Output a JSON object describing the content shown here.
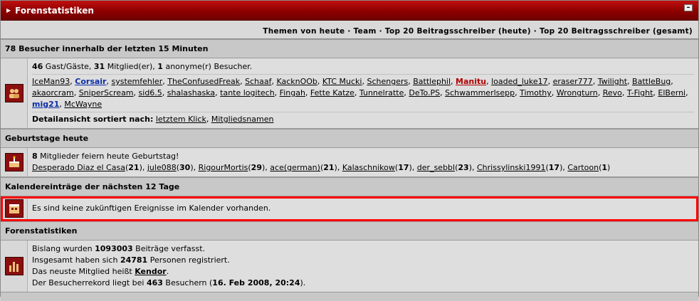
{
  "header": {
    "title": "Forenstatistiken",
    "collapse_symbol": "–"
  },
  "links": [
    {
      "label": "Themen von heute"
    },
    {
      "label": "Team"
    },
    {
      "label": "Top 20 Beitragsschreiber (heute)"
    },
    {
      "label": "Top 20 Beitragsschreiber (gesamt)"
    }
  ],
  "visitors": {
    "heading": "78 Besucher innerhalb der letzten 15 Minuten",
    "guests_count": "46",
    "guests_label": " Gast/Gäste, ",
    "members_count": "31",
    "members_label": " Mitglied(er), ",
    "anon_count": "1",
    "anon_label": " anonyme(r) Besucher.",
    "users": [
      {
        "name": "IceMan93",
        "style": "u"
      },
      {
        "name": "Corsair",
        "style": "blue"
      },
      {
        "name": "systemfehler",
        "style": "u"
      },
      {
        "name": "TheConfusedFreak",
        "style": "u"
      },
      {
        "name": "Schaaf",
        "style": "u"
      },
      {
        "name": "KacknOOb",
        "style": "u"
      },
      {
        "name": "KTC Mucki",
        "style": "u"
      },
      {
        "name": "Schengers",
        "style": "u"
      },
      {
        "name": "Battlephil",
        "style": "u"
      },
      {
        "name": "Manitu",
        "style": "red"
      },
      {
        "name": "loaded_luke17",
        "style": "u"
      },
      {
        "name": "eraser777",
        "style": "u"
      },
      {
        "name": "Twilight",
        "style": "u"
      },
      {
        "name": "BattleBug",
        "style": "u"
      },
      {
        "name": "akaorcram",
        "style": "u"
      },
      {
        "name": "SniperScream",
        "style": "u"
      },
      {
        "name": "sid6.5",
        "style": "u"
      },
      {
        "name": "shalashaska",
        "style": "u"
      },
      {
        "name": "tante logitech",
        "style": "u"
      },
      {
        "name": "Fingah",
        "style": "u"
      },
      {
        "name": "Fette Katze",
        "style": "u"
      },
      {
        "name": "Tunnelratte",
        "style": "u"
      },
      {
        "name": "DeTo.PS",
        "style": "u"
      },
      {
        "name": "Schwammerlsepp",
        "style": "u"
      },
      {
        "name": "Timothy",
        "style": "u"
      },
      {
        "name": "Wrongturn",
        "style": "u"
      },
      {
        "name": "Revo",
        "style": "u"
      },
      {
        "name": "T-Fight",
        "style": "u"
      },
      {
        "name": "ElBerni",
        "style": "u"
      },
      {
        "name": "mig21",
        "style": "blue"
      },
      {
        "name": "McWayne",
        "style": "u"
      }
    ],
    "sort_label": "Detailansicht sortiert nach:",
    "sort_by_click": "letztem Klick",
    "sort_by_name": "Mitgliedsnamen"
  },
  "birthdays": {
    "heading": "Geburtstage heute",
    "count": "8",
    "text": " Mitglieder feiern heute Geburtstag!",
    "people": [
      {
        "name": "Desperado Diaz el Casa",
        "age": "21"
      },
      {
        "name": "jule088",
        "age": "30"
      },
      {
        "name": "RigourMortis",
        "age": "29"
      },
      {
        "name": "ace(german)",
        "age": "21"
      },
      {
        "name": "Kalaschnikow",
        "age": "17"
      },
      {
        "name": "der_sebbl",
        "age": "23"
      },
      {
        "name": "Chrissylinski1991",
        "age": "17"
      },
      {
        "name": "Cartoon",
        "age": "1"
      }
    ]
  },
  "calendar": {
    "heading": "Kalendereinträge der nächsten 12 Tage",
    "message": "Es sind keine zukünftigen Ereignisse im Kalender vorhanden."
  },
  "stats": {
    "heading": "Forenstatistiken",
    "line1_pre": "Bislang wurden ",
    "posts": "1093003",
    "line1_post": " Beiträge verfasst.",
    "line2_pre": "Insgesamt haben sich ",
    "registered": "24781",
    "line2_post": " Personen registriert.",
    "line3_pre": "Das neuste Mitglied heißt ",
    "newest": "Kendor",
    "line3_post": ".",
    "line4_pre": "Der Besucherrekord liegt bei ",
    "record": "463",
    "line4_mid": " Besuchern (",
    "record_date": "16. Feb 2008, 20:24",
    "line4_post": ")."
  },
  "colors": {
    "title_bar": "#a00000",
    "highlight": "#ff0000",
    "member_blue": "#0a2ca8",
    "member_red": "#b00000"
  },
  "icons": {
    "visitors": "users-icon",
    "birthdays": "cake-icon",
    "calendar": "calendar-icon",
    "stats": "bar-chart-icon"
  }
}
